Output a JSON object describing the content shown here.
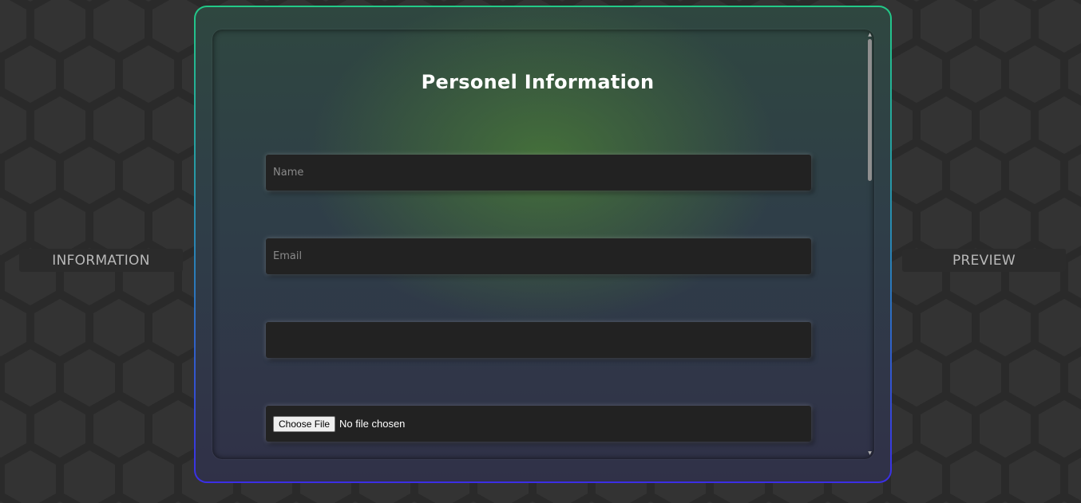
{
  "background": {
    "color": "#2a2a2a",
    "hex_color": "#222222"
  },
  "nav": {
    "left_tab": "INFORMATION",
    "right_tab": "PREVIEW"
  },
  "frame": {
    "gradient_top": "#22c987",
    "gradient_bottom": "#3b2ee6"
  },
  "form": {
    "title": "Personel Information",
    "name": {
      "placeholder": "Name",
      "value": ""
    },
    "email": {
      "placeholder": "Email",
      "value": ""
    },
    "blank": {
      "placeholder": "",
      "value": ""
    },
    "file": {
      "button_label": "Choose File",
      "status": "No file chosen"
    }
  }
}
